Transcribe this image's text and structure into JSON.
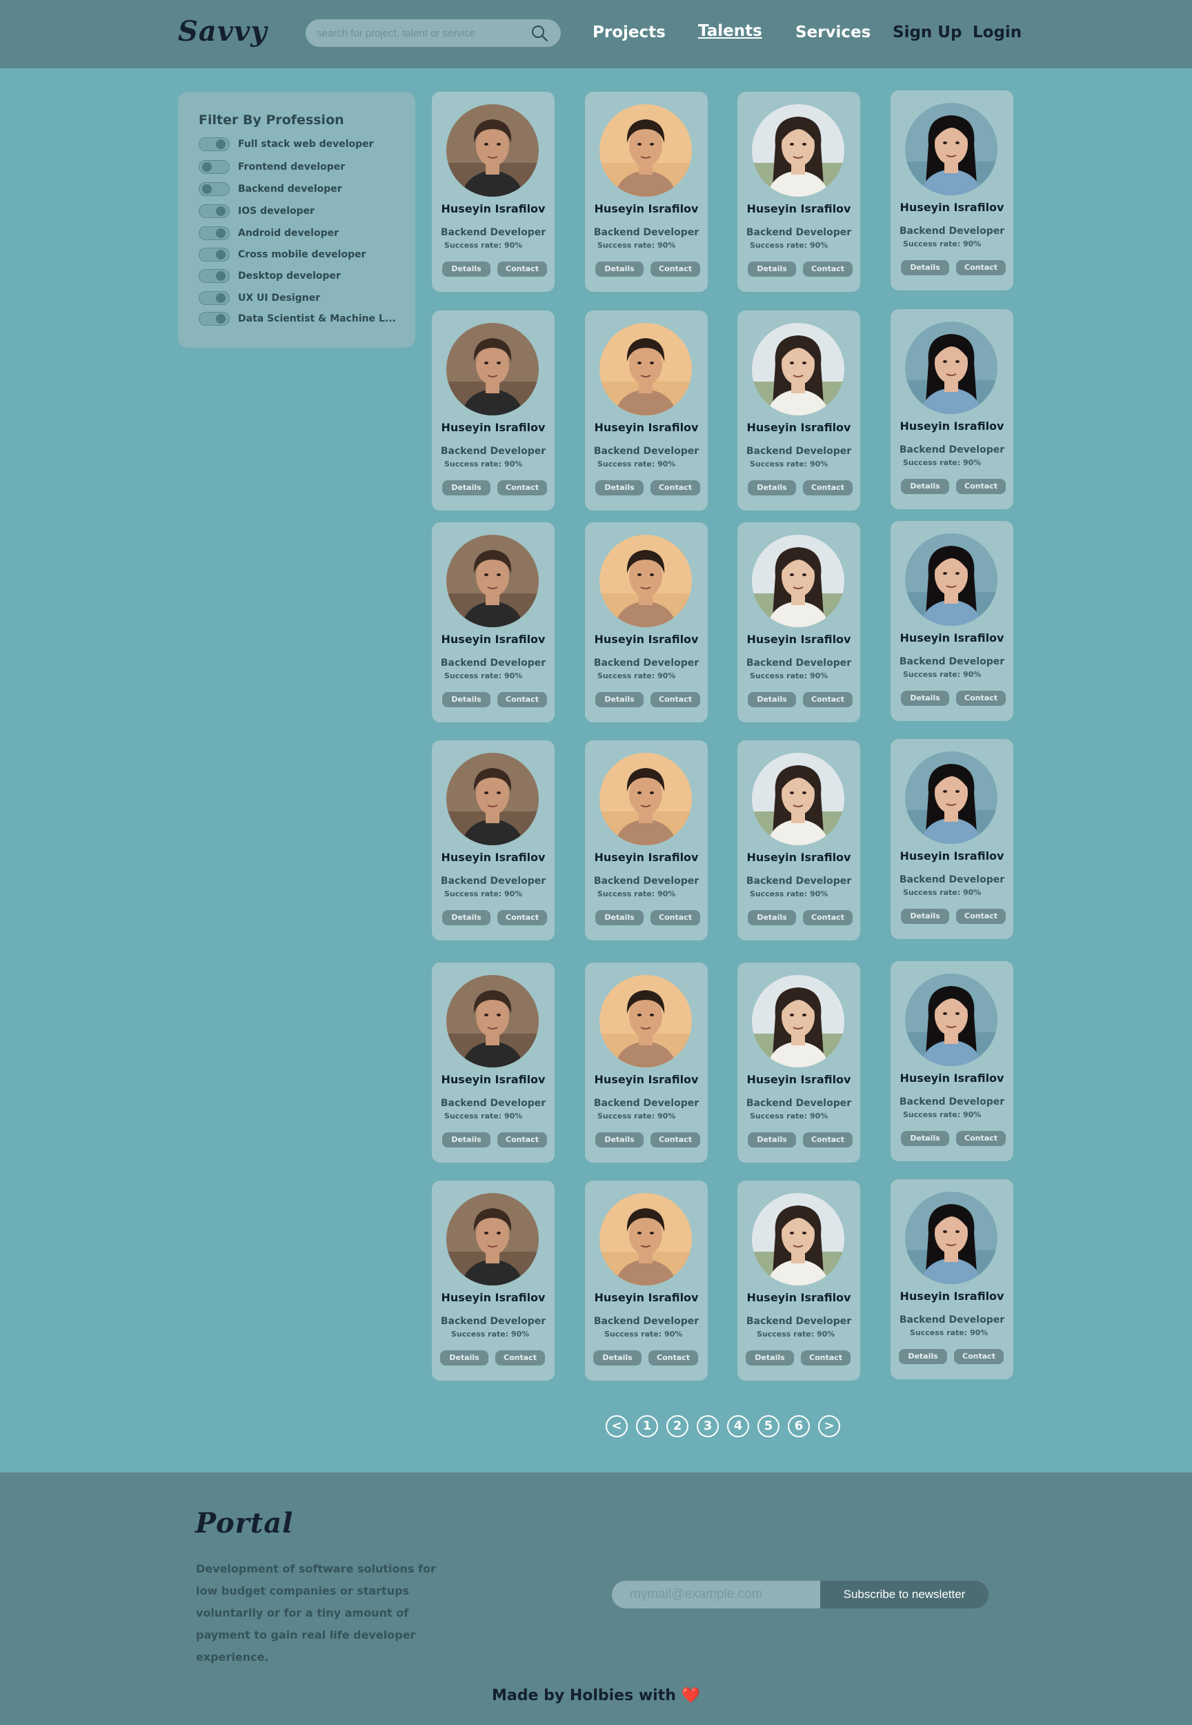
{
  "header": {
    "logo": "Savvy",
    "search_placeholder": "search for project, talent or service",
    "nav": [
      {
        "label": "Projects"
      },
      {
        "label": "Talents"
      },
      {
        "label": "Services"
      },
      {
        "label": "Sign Up"
      },
      {
        "label": "Login"
      }
    ]
  },
  "sidebar": {
    "title": "Filter By Profession",
    "filters": [
      {
        "label": "Full stack web developer"
      },
      {
        "label": "Frontend developer"
      },
      {
        "label": "Backend developer"
      },
      {
        "label": "IOS developer"
      },
      {
        "label": "Android developer"
      },
      {
        "label": "Cross mobile developer"
      },
      {
        "label": "Desktop developer"
      },
      {
        "label": "UX UI Designer"
      },
      {
        "label": "Data Scientist & Machine L..."
      }
    ]
  },
  "talents": {
    "name": "Huseyin Israfilov",
    "role": "Backend Developer",
    "rate": "Success rate: 90%",
    "details_label": "Details",
    "contact_label": "Contact",
    "rows": 6,
    "columns": 4
  },
  "pagination": [
    "<",
    "1",
    "2",
    "3",
    "4",
    "5",
    "6",
    ">"
  ],
  "footer": {
    "logo": "Portal",
    "description": "Development of software solutions for low budget companies or startups voluntarily or for a tiny amount of payment to gain real life developer experience.",
    "email_placeholder": "mymail@example.com",
    "subscribe_label": "Subscribe to newsletter",
    "made_by": "Made by Holbies with",
    "heart": "❤️"
  },
  "colors": {
    "page_bg": "#6eaeb6",
    "header_bg": "#5c868c",
    "card_bg": "#a0c4c8",
    "button_bg": "#6f8c90",
    "heart": "#d7262e"
  }
}
